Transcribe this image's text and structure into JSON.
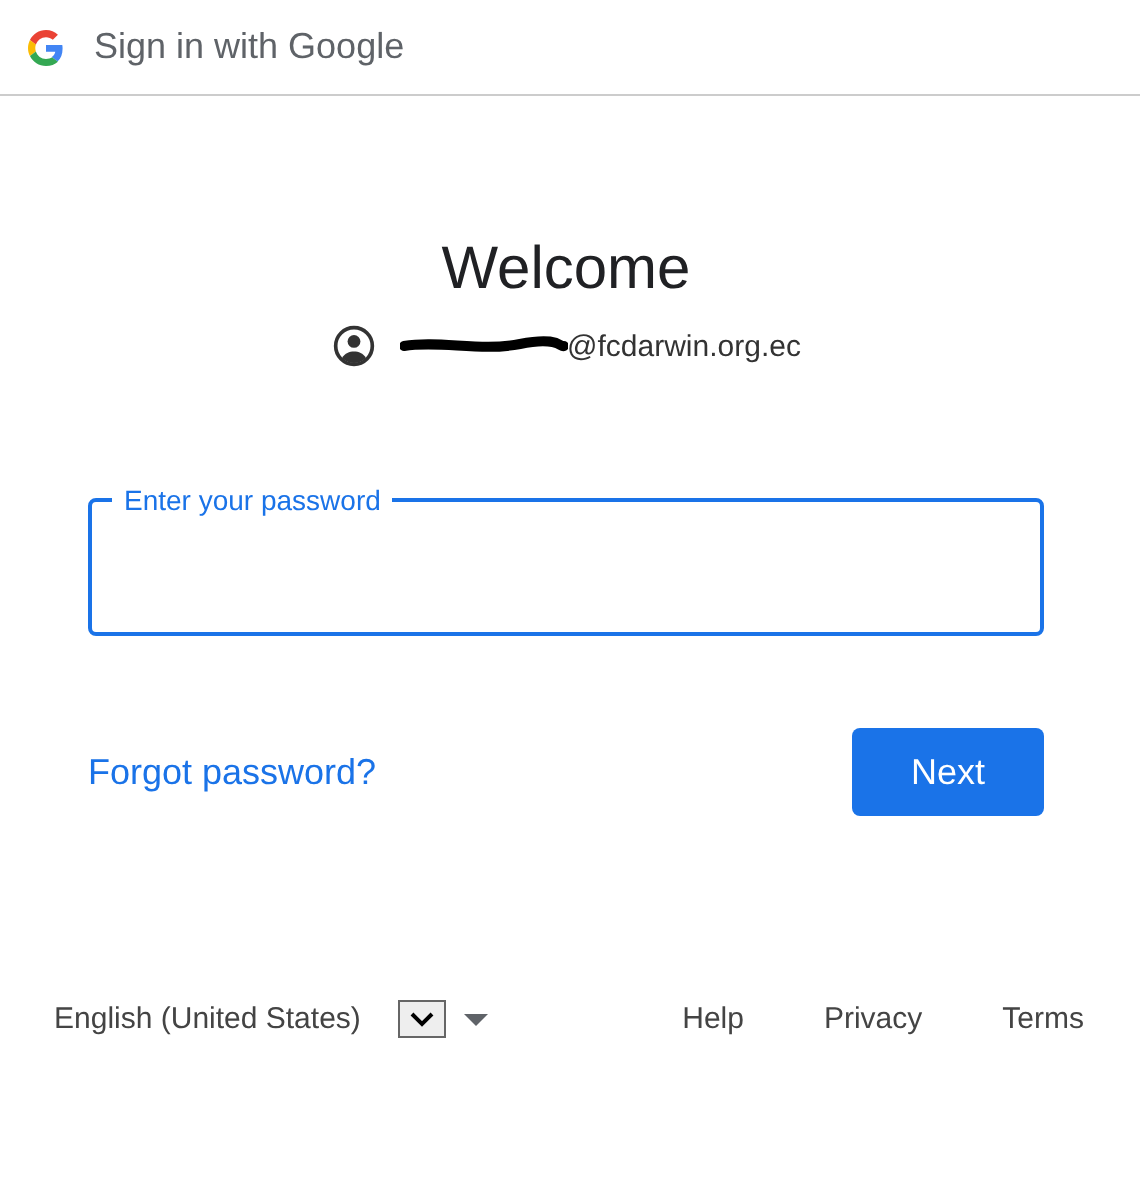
{
  "header": {
    "title": "Sign in with Google"
  },
  "heading": "Welcome",
  "account": {
    "email_visible": "@fcdarwin.org.ec",
    "redacted": true
  },
  "password_field": {
    "label": "Enter your password",
    "focused": true
  },
  "forgot_link": "Forgot password?",
  "next_button": "Next",
  "footer": {
    "language": "English (United States)",
    "links": [
      "Help",
      "Privacy",
      "Terms"
    ]
  }
}
